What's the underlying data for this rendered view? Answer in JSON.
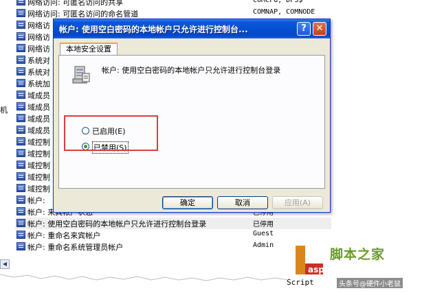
{
  "background": {
    "left_text": "机",
    "rows": [
      {
        "name": "网络访问: 可匿名访问的共享",
        "value": "COMCFG, DFS$"
      },
      {
        "name": "网络访问: 可匿名访问的命名管道",
        "value": "COMNAP, COMNODE"
      },
      {
        "name": "网络访",
        "value": ""
      },
      {
        "name": "网络访",
        "value": ""
      },
      {
        "name": "网络访",
        "value": ""
      },
      {
        "name": "系统对",
        "value": ""
      },
      {
        "name": "系统对",
        "value": ""
      },
      {
        "name": "系统加",
        "value": ""
      },
      {
        "name": "域成员",
        "value": ""
      },
      {
        "name": "域成员",
        "value": ""
      },
      {
        "name": "域成员",
        "value": ""
      },
      {
        "name": "域成员",
        "value": ""
      },
      {
        "name": "域控制",
        "value": ""
      },
      {
        "name": "域控制",
        "value": ""
      },
      {
        "name": "域控制",
        "value": ""
      },
      {
        "name": "域控制",
        "value": ""
      },
      {
        "name": "域控制",
        "value": ""
      },
      {
        "name": "帐户:",
        "value": ""
      },
      {
        "name": "帐户: 来宾帐户状态",
        "value": "已停用"
      },
      {
        "name": "帐户: 使用空白密码的本地帐户只允许进行控制台登录",
        "value": "已停用"
      },
      {
        "name": "帐户: 重命名来宾帐户",
        "value": "Guest"
      },
      {
        "name": "帐户: 重命名系统管理员帐户",
        "value": "Admin"
      }
    ]
  },
  "dialog": {
    "title": "帐户: 使用空白密码的本地帐户只允许进行控制台...",
    "help_button": "?",
    "close_button": "✕",
    "tab_label": "本地安全设置",
    "policy_text": "帐户: 使用空白密码的本地帐户只允许进行控制台登录",
    "enabled_label": "已启用(E)",
    "disabled_label": "已禁用(S)",
    "selected": "disabled",
    "ok_button": "确定",
    "cancel_button": "取消",
    "apply_button": "应用(A)"
  },
  "watermark": {
    "script_text": "Script",
    "logo_text": "脚本之家",
    "sub_text": "头条号@硬件小老鼠"
  },
  "colors": {
    "titlebar": "#0550d0",
    "highlight_border": "#e0383b",
    "dialog_bg": "#ece9d8"
  }
}
